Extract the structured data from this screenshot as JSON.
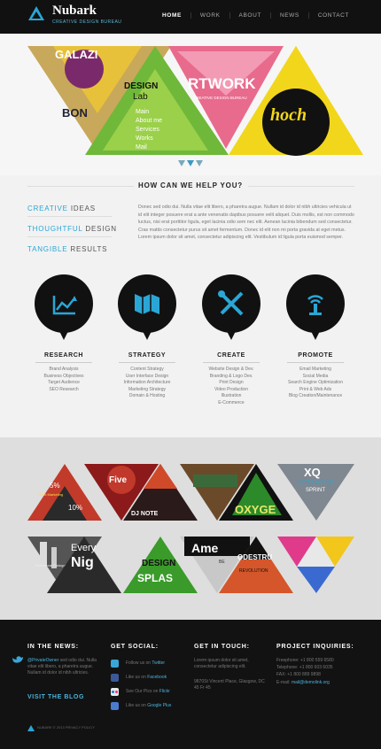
{
  "brand": {
    "name": "Nubark",
    "tagline": "CREATIVE DESIGN BUREAU"
  },
  "nav": [
    {
      "label": "HOME",
      "active": true
    },
    {
      "label": "WORK",
      "active": false
    },
    {
      "label": "ABOUT",
      "active": false
    },
    {
      "label": "NEWS",
      "active": false
    },
    {
      "label": "CONTACT",
      "active": false
    }
  ],
  "hero": {
    "slides_text": [
      "GALAZI",
      "BON",
      "DESIGN",
      "Lab",
      "Main",
      "About me",
      "Services",
      "Works",
      "Mail",
      "RTWORK",
      "CREATIVE DESIGN BUREAU",
      "hoch"
    ]
  },
  "help": {
    "title": "HOW CAN WE HELP YOU?",
    "ideas": [
      {
        "highlight": "CREATIVE",
        "rest": " IDEAS"
      },
      {
        "highlight": "THOUGHTFUL",
        "rest": " DESIGN"
      },
      {
        "highlight": "TANGIBLE",
        "rest": " RESULTS"
      }
    ],
    "body": "Donec sed odio dui. Nulla vitae elit libero, a pharetra augue. Nullam id dolor id nibh ultricies vehicula ut id elit integer posuere erat a ante venenatis dapibus posuere velit aliquet. Duis mollis, est non commodo luctus, nisi erat porttitor ligula, eget lacinia odio sem nec elit. Aenean lacinia bibendum sed consectetur. Cras mattis consectetur purus sit amet fermentum. Donec id elit non mi porta gravida at eget metus. Lorem ipsum dolor sit amet, consectetur adipiscing elit. Vestibulum id ligula porta euismod semper."
  },
  "services": [
    {
      "title": "RESEARCH",
      "icon": "chart-line-icon",
      "items": [
        "Brand Analysis",
        "Business Objectives",
        "Target Audience",
        "SEO Research"
      ]
    },
    {
      "title": "STRATEGY",
      "icon": "map-icon",
      "items": [
        "Content Strategy",
        "User Interface Design",
        "Information Architecture",
        "Marketing Strategy",
        "Domain & Hosting"
      ]
    },
    {
      "title": "CREATE",
      "icon": "design-tools-icon",
      "items": [
        "Website Design & Dev.",
        "Branding & Logo Dev.",
        "Print Design",
        "Video Production",
        "Illustration",
        "E-Commerce"
      ]
    },
    {
      "title": "PROMOTE",
      "icon": "broadcast-tower-icon",
      "items": [
        "Email Marketing",
        "Social Media",
        "Search Engine Optimization",
        "Print & Web Ads",
        "Blog Creation/Maintenance"
      ]
    }
  ],
  "portfolio": {
    "texts": [
      "5%",
      "Direct Marketing",
      "10%",
      "Five",
      "DJ NOTE",
      "OXYGE",
      "XQ",
      "INTERACTIVE",
      "SPRINT",
      "Every",
      "Nig",
      "Professional Photography",
      "DESIGN",
      "SPLAS",
      "Ame",
      "BE",
      "ODESTRU",
      "REVOLUTION"
    ]
  },
  "footer": {
    "news_title": "IN THE NEWS:",
    "news_handle": "@PrivateOwner",
    "news_text": " sed odio dui. Nulla vitae elit libero, a pharetra augue. Nullam id dolor id nibh ultricies.",
    "blog_link": "VISIT THE BLOG",
    "social_title": "GET SOCIAL:",
    "social": [
      {
        "prefix": "Follow us on ",
        "link": "Twitter",
        "icon": "twitter-icon",
        "color": "#3aa6d8"
      },
      {
        "prefix": "Like us on ",
        "link": "Facebook",
        "icon": "facebook-icon",
        "color": "#3b5998"
      },
      {
        "prefix": "See Our Pics on ",
        "link": "Flickr",
        "icon": "flickr-icon",
        "color": "#e8e8e8"
      },
      {
        "prefix": "Like us on ",
        "link": "Google Plus",
        "icon": "google-plus-icon",
        "color": "#4b7bd0"
      }
    ],
    "touch_title": "GET IN TOUCH:",
    "touch_text": "Lorem ipsum dolor sit amet, consectetur adipiscing elit.",
    "address": "9870St Vincent Place, Glasgow, DC 45 Fr 45",
    "proj_title": "PROJECT INQUIRIES:",
    "freephone": "Freephone: +1 800 559 6580",
    "telephone": "Telephone: +1 800 603 6035",
    "fax": "FAX: +1 800 889 9898",
    "email_label": "E-mail: ",
    "email": "mail@demolink.org",
    "copyright": "NUBARK © 2013 PRIVACY POLICY"
  },
  "colors": {
    "accent": "#2aa6d6",
    "dark": "#111111"
  }
}
